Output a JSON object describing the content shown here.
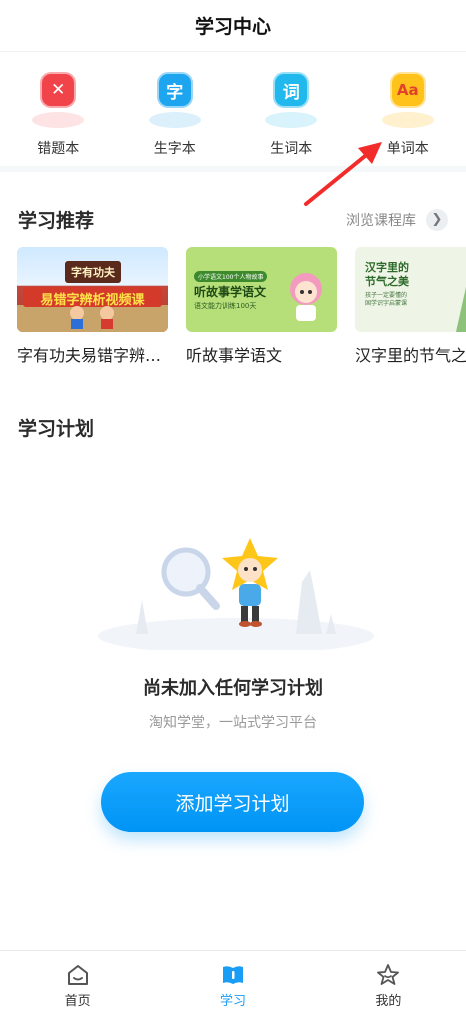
{
  "header": {
    "title": "学习中心"
  },
  "tools": [
    {
      "label": "错题本",
      "glyph": "✕",
      "color": "#f0444a",
      "shadow": "#fde3e4",
      "icon": "wrong-book-icon"
    },
    {
      "label": "生字本",
      "glyph": "字",
      "color": "#1ea5f0",
      "shadow": "#dcf0fb",
      "icon": "character-book-icon"
    },
    {
      "label": "生词本",
      "glyph": "词",
      "color": "#21b8ee",
      "shadow": "#d9f3fc",
      "icon": "word-book-icon"
    },
    {
      "label": "单词本",
      "glyph": "Aa",
      "color": "#ffc21a",
      "shadow": "#fff1cd",
      "icon": "vocabulary-book-icon"
    }
  ],
  "recommend": {
    "title": "学习推荐",
    "browse_label": "浏览课程库",
    "courses": [
      {
        "title": "字有功夫易错字辨析视频课",
        "thumb_line1": "字有功夫",
        "thumb_line2": "易错字辨析视频课"
      },
      {
        "title": "听故事学语文",
        "thumb_badge": "小学语文100个人物故事",
        "thumb_line1": "听故事学语文",
        "thumb_line2": "语文能力训练100天"
      },
      {
        "title": "汉字里的节气之美",
        "thumb_line1": "汉字里的",
        "thumb_line2": "节气之美",
        "thumb_line3": "孩子一定要懂的",
        "thumb_line4": "国学识字启蒙课"
      }
    ]
  },
  "plan": {
    "title": "学习计划",
    "empty_title": "尚未加入任何学习计划",
    "empty_subtitle": "淘知学堂，一站式学习平台",
    "add_button": "添加学习计划"
  },
  "tabbar": [
    {
      "label": "首页",
      "icon": "home-icon",
      "active": false
    },
    {
      "label": "学习",
      "icon": "book-icon",
      "active": true
    },
    {
      "label": "我的",
      "icon": "profile-star-icon",
      "active": false
    }
  ],
  "colors": {
    "accent": "#0f9ff5",
    "active_tab": "#1a9df6"
  }
}
